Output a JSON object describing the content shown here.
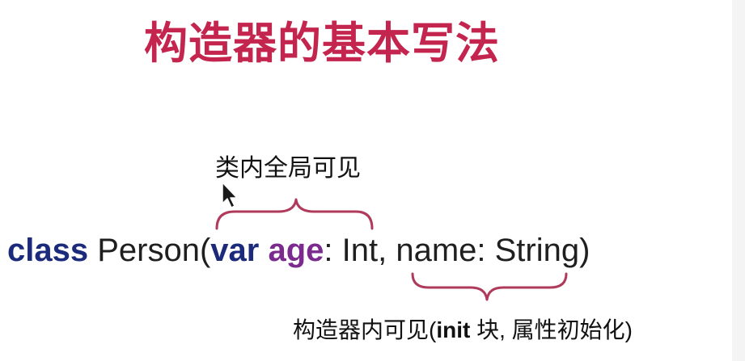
{
  "slide": {
    "title": "构造器的基本写法",
    "code": {
      "keyword_class": "class",
      "class_name": " Person(",
      "keyword_var": "var",
      "space": " ",
      "param_age": "age",
      "rest": ": Int, name: String)"
    },
    "note_top": "类内全局可见",
    "note_bottom": {
      "prefix": "构造器内可见(",
      "init_word": "init",
      "suffix": " 块, 属性初始化)"
    }
  },
  "colors": {
    "title": "#c4254e",
    "keyword_class": "#1b2a7a",
    "keyword_var": "#1b2a7a",
    "param_age": "#7b2a8e",
    "code_text": "#1f1f1f",
    "brace": "#b03a5b"
  }
}
